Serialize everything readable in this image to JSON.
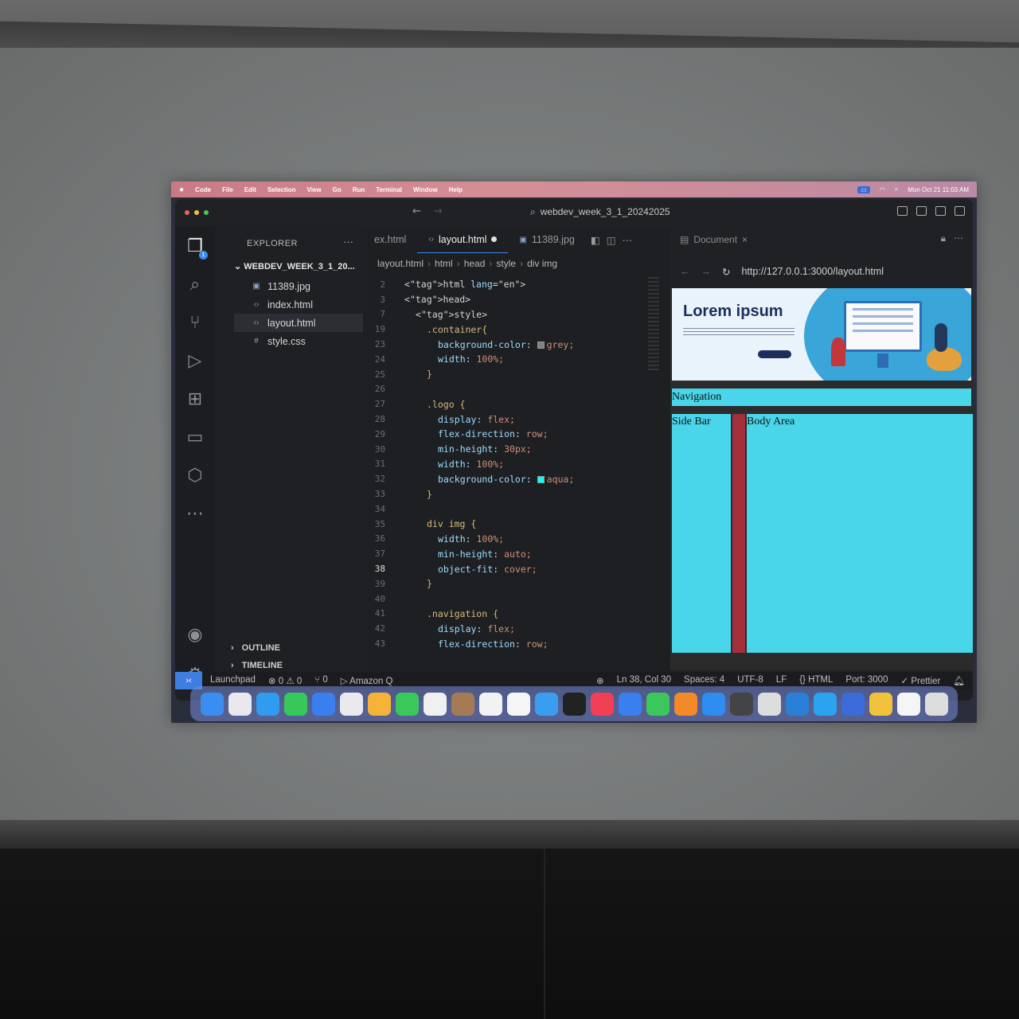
{
  "menubar": {
    "apple": "",
    "items": [
      "Code",
      "File",
      "Edit",
      "Selection",
      "View",
      "Go",
      "Run",
      "Terminal",
      "Window",
      "Help"
    ],
    "clock": "Mon Oct 21  11:03 AM"
  },
  "titlebar": {
    "back": "←",
    "forward": "→",
    "search_text": "webdev_week_3_1_20242025"
  },
  "sidebar": {
    "header": "EXPLORER",
    "more": "···",
    "folder": "WEBDEV_WEEK_3_1_20...",
    "files": [
      {
        "name": "11389.jpg",
        "icon": "image-icon"
      },
      {
        "name": "index.html",
        "icon": "code-icon"
      },
      {
        "name": "layout.html",
        "icon": "code-icon"
      },
      {
        "name": "style.css",
        "icon": "hash-icon"
      }
    ],
    "outline": "OUTLINE",
    "timeline": "TIMELINE"
  },
  "editor": {
    "tabs": [
      {
        "label": "ex.html"
      },
      {
        "label": "layout.html"
      },
      {
        "label": "11389.jpg"
      }
    ],
    "breadcrumb": [
      "layout.html",
      "html",
      "head",
      "style",
      "div img"
    ],
    "lines": [
      {
        "n": "2",
        "indent": 2,
        "text": "<html lang=\"en\">"
      },
      {
        "n": "3",
        "indent": 2,
        "text": "<head>"
      },
      {
        "n": "7",
        "indent": 4,
        "text": "<style>"
      },
      {
        "n": "19",
        "indent": 6,
        "text": ".container{"
      },
      {
        "n": "23",
        "indent": 8,
        "text": "background-color: grey;",
        "swatch": "#808080"
      },
      {
        "n": "24",
        "indent": 8,
        "text": "width: 100%;"
      },
      {
        "n": "25",
        "indent": 6,
        "text": "}"
      },
      {
        "n": "26",
        "indent": 0,
        "text": ""
      },
      {
        "n": "27",
        "indent": 6,
        "text": ".logo {"
      },
      {
        "n": "28",
        "indent": 8,
        "text": "display: flex;"
      },
      {
        "n": "29",
        "indent": 8,
        "text": "flex-direction: row;"
      },
      {
        "n": "30",
        "indent": 8,
        "text": "min-height: 30px;"
      },
      {
        "n": "31",
        "indent": 8,
        "text": "width: 100%;"
      },
      {
        "n": "32",
        "indent": 8,
        "text": "background-color: aqua;",
        "swatch": "#00ffff"
      },
      {
        "n": "33",
        "indent": 6,
        "text": "}"
      },
      {
        "n": "34",
        "indent": 0,
        "text": ""
      },
      {
        "n": "35",
        "indent": 6,
        "text": "div img {"
      },
      {
        "n": "36",
        "indent": 8,
        "text": "width:100%;"
      },
      {
        "n": "37",
        "indent": 8,
        "text": "min-height: auto;"
      },
      {
        "n": "38",
        "indent": 8,
        "text": "object-fit: cover;",
        "current": true
      },
      {
        "n": "39",
        "indent": 6,
        "text": "}"
      },
      {
        "n": "40",
        "indent": 0,
        "text": ""
      },
      {
        "n": "41",
        "indent": 6,
        "text": ".navigation {"
      },
      {
        "n": "42",
        "indent": 8,
        "text": "display: flex;"
      },
      {
        "n": "43",
        "indent": 8,
        "text": "flex-direction: row;"
      }
    ]
  },
  "preview": {
    "tab": "Document",
    "url": "http://127.0.0.1:3000/layout.html",
    "hero_title": "Lorem ipsum",
    "navigation": "Navigation",
    "side_bar": "Side Bar",
    "body_area": "Body Area"
  },
  "statusbar": {
    "launchpad": "Launchpad",
    "errors": "⊗ 0 ⚠ 0",
    "ports": "⑂ 0",
    "amazon_q": "▷ Amazon Q",
    "position": "Ln 38, Col 30",
    "spaces": "Spaces: 4",
    "encoding": "UTF-8",
    "eol": "LF",
    "language": "{} HTML",
    "port": "Port: 3000",
    "prettier": "✓ Prettier"
  },
  "dock": {
    "colors": [
      "#3a8ef0",
      "#e8e8ee",
      "#2f9cf0",
      "#38c85a",
      "#3a7ff0",
      "#e9e9ef",
      "#f5b33a",
      "#3ac85a",
      "#f0f0f0",
      "#a57a55",
      "#f2f2f2",
      "#f5f5f5",
      "#3a9ef0",
      "#222222",
      "#f23f56",
      "#3a7ff0",
      "#3ac85a",
      "#f28a2a",
      "#2f8cf0",
      "#444444",
      "#dddddd",
      "#2a7fd6",
      "#2aa4f0",
      "#3a6bd9",
      "#f2c23a",
      "#f5f5f5",
      "#dddddd"
    ]
  }
}
